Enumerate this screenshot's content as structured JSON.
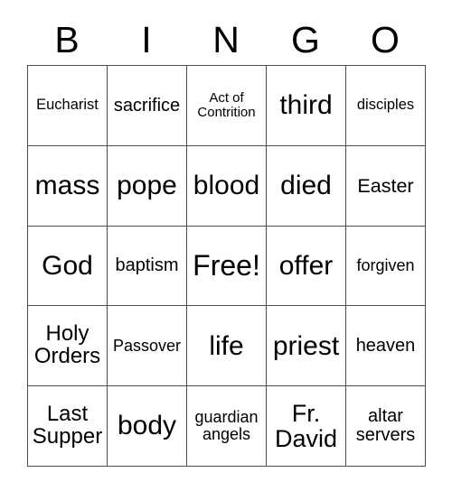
{
  "card": {
    "title": "BINGO",
    "headers": [
      "B",
      "I",
      "N",
      "G",
      "O"
    ],
    "rows": [
      [
        {
          "text": "Eucharist",
          "size": "s"
        },
        {
          "text": "sacrifice",
          "size": "m"
        },
        {
          "text": "Act of Contrition",
          "size": "xs"
        },
        {
          "text": "third",
          "size": "xxl"
        },
        {
          "text": "disciples",
          "size": "s"
        }
      ],
      [
        {
          "text": "mass",
          "size": "xxl"
        },
        {
          "text": "pope",
          "size": "xxl"
        },
        {
          "text": "blood",
          "size": "xxl"
        },
        {
          "text": "died",
          "size": "xxl"
        },
        {
          "text": "Easter",
          "size": "ml"
        }
      ],
      [
        {
          "text": "God",
          "size": "xxl"
        },
        {
          "text": "baptism",
          "size": "m"
        },
        {
          "text": "Free!",
          "size": "free"
        },
        {
          "text": "offer",
          "size": "xxl"
        },
        {
          "text": "forgiven",
          "size": "sm"
        }
      ],
      [
        {
          "text": "Holy Orders",
          "size": "l"
        },
        {
          "text": "Passover",
          "size": "sm"
        },
        {
          "text": "life",
          "size": "xxl"
        },
        {
          "text": "priest",
          "size": "xxl"
        },
        {
          "text": "heaven",
          "size": "m"
        }
      ],
      [
        {
          "text": "Last Supper",
          "size": "l"
        },
        {
          "text": "body",
          "size": "xxl"
        },
        {
          "text": "guardian angels",
          "size": "sm"
        },
        {
          "text": "Fr. David",
          "size": "xl"
        },
        {
          "text": "altar servers",
          "size": "m"
        }
      ]
    ],
    "free_space": {
      "row": 2,
      "col": 2,
      "label": "Free!"
    },
    "colors": {
      "background": "#ffffff",
      "text": "#000000",
      "grid_line": "#4d4d4d"
    }
  }
}
